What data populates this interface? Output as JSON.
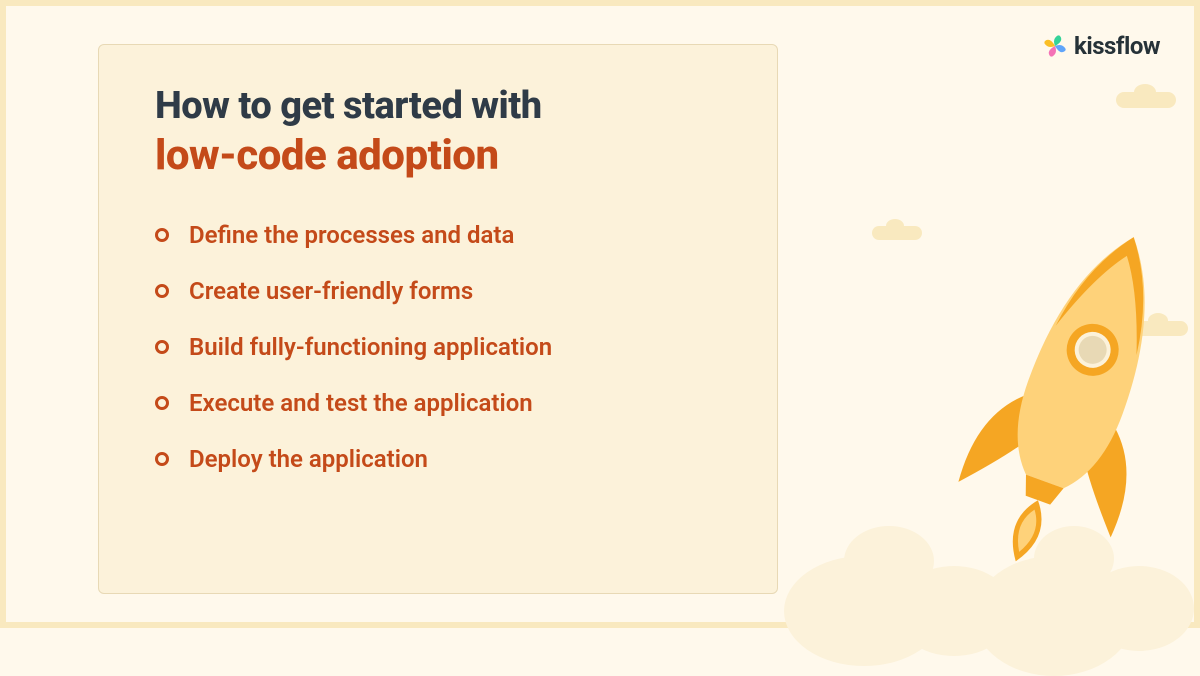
{
  "logo": {
    "text": "kissflow",
    "icon_name": "kissflow-logo-icon"
  },
  "card": {
    "title_line1": "How to get started with",
    "title_line2": "low-code adoption",
    "list_items": [
      {
        "label": "Define the processes and data"
      },
      {
        "label": "Create user-friendly forms"
      },
      {
        "label": "Build fully-functioning application"
      },
      {
        "label": "Execute and test the application"
      },
      {
        "label": "Deploy the application"
      }
    ]
  },
  "colors": {
    "background": "#FFF9EC",
    "card_bg": "#FCF2DA",
    "card_border": "#E8D9B5",
    "frame": "#F9E9BF",
    "title_dark": "#2F3B47",
    "accent": "#C44A19"
  },
  "illustration": {
    "name": "rocket-launch",
    "rocket_body": "#FED27A",
    "rocket_accent": "#F5A623",
    "flame": "#F5A623"
  }
}
